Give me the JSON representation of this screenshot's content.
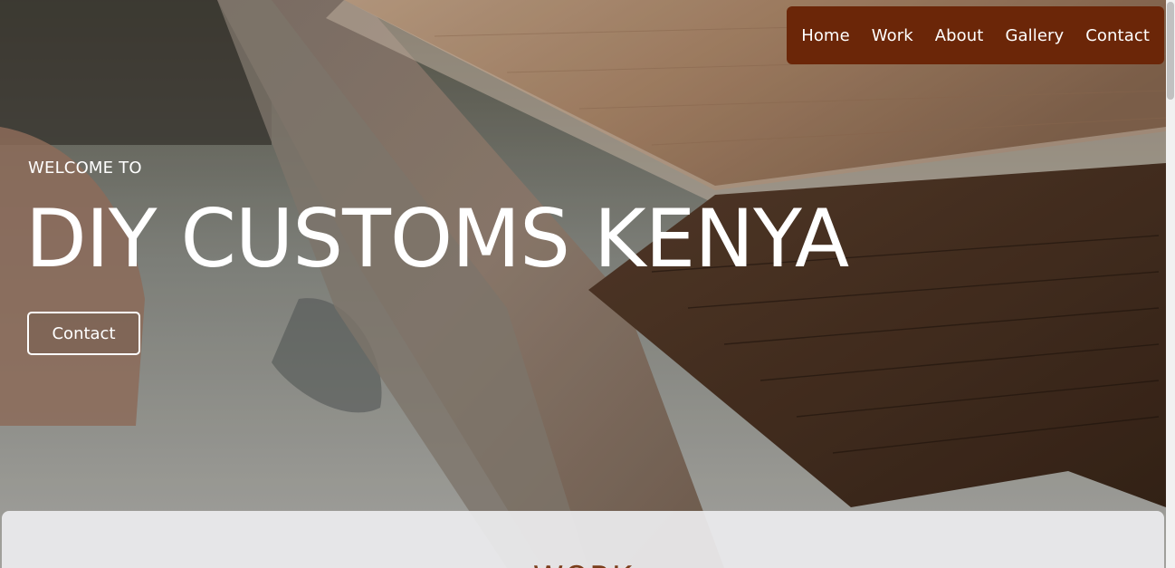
{
  "colors": {
    "nav_bg": "#6b2608",
    "accent": "#7a3d1a",
    "text_light": "#ffffff"
  },
  "nav": {
    "items": [
      {
        "label": "Home"
      },
      {
        "label": "Work"
      },
      {
        "label": "About"
      },
      {
        "label": "Gallery"
      },
      {
        "label": "Contact"
      }
    ]
  },
  "hero": {
    "welcome": "WELCOME TO",
    "headline": "DIY CUSTOMS KENYA",
    "button_label": "Contact",
    "background": "wooden-table-photo"
  },
  "section": {
    "title": "WORK"
  }
}
